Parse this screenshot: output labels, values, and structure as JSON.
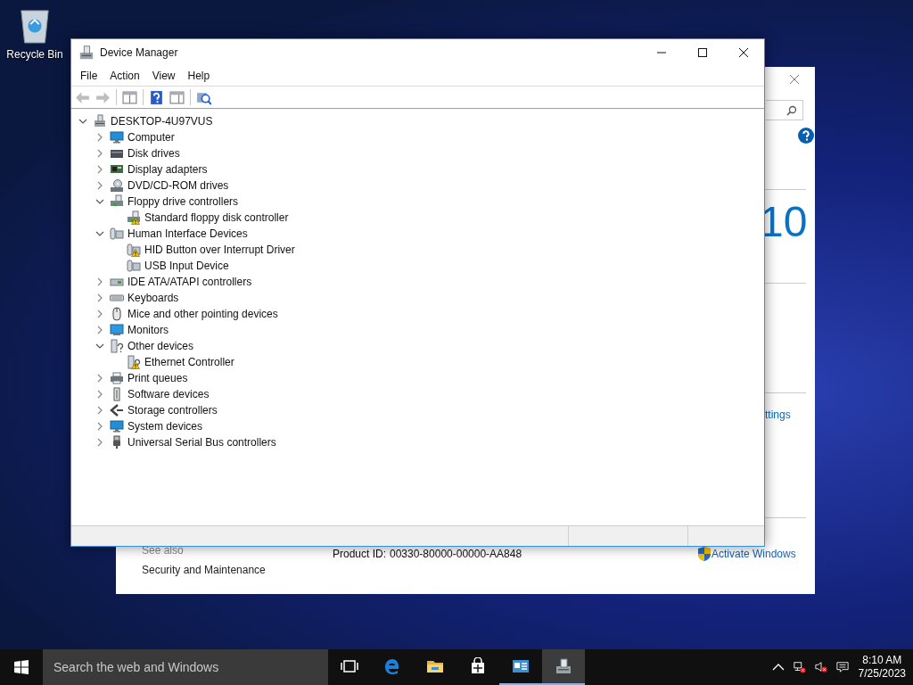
{
  "desktop_icons": [
    {
      "label": "Recycle Bin"
    }
  ],
  "background_window": {
    "logo_text": "10",
    "link": "ttings",
    "see_also": "See also",
    "see_also_link": "Security and Maintenance",
    "product_id_label": "Product ID:",
    "product_id": "00330-80000-00000-AA848",
    "activate_link": "Activate Windows"
  },
  "window": {
    "title": "Device Manager"
  },
  "menu": [
    "File",
    "Action",
    "View",
    "Help"
  ],
  "toolbar": [
    {
      "kind": "back",
      "disabled": true
    },
    {
      "kind": "forward",
      "disabled": true
    },
    {
      "kind": "sep"
    },
    {
      "kind": "console",
      "disabled": false
    },
    {
      "kind": "sep"
    },
    {
      "kind": "help",
      "disabled": false
    },
    {
      "kind": "pane",
      "disabled": false
    },
    {
      "kind": "sep"
    },
    {
      "kind": "scan",
      "disabled": false
    }
  ],
  "tree": {
    "label": "DESKTOP-4U97VUS",
    "kind": "root",
    "expanded": true,
    "children": [
      {
        "label": "Computer",
        "kind": "computer",
        "expanded": false
      },
      {
        "label": "Disk drives",
        "kind": "disk",
        "expanded": false
      },
      {
        "label": "Display adapters",
        "kind": "display",
        "expanded": false
      },
      {
        "label": "DVD/CD-ROM drives",
        "kind": "dvd",
        "expanded": false
      },
      {
        "label": "Floppy drive controllers",
        "kind": "floppy",
        "expanded": true,
        "children": [
          {
            "label": "Standard floppy disk controller",
            "kind": "floppy",
            "warning": true
          }
        ]
      },
      {
        "label": "Human Interface Devices",
        "kind": "hid",
        "expanded": true,
        "children": [
          {
            "label": "HID Button over Interrupt Driver",
            "kind": "hid",
            "warning": true
          },
          {
            "label": "USB Input Device",
            "kind": "hid",
            "warning": false
          }
        ]
      },
      {
        "label": "IDE ATA/ATAPI controllers",
        "kind": "ide",
        "expanded": false
      },
      {
        "label": "Keyboards",
        "kind": "keyboard",
        "expanded": false
      },
      {
        "label": "Mice and other pointing devices",
        "kind": "mouse",
        "expanded": false
      },
      {
        "label": "Monitors",
        "kind": "monitor",
        "expanded": false
      },
      {
        "label": "Other devices",
        "kind": "other",
        "expanded": true,
        "children": [
          {
            "label": "Ethernet Controller",
            "kind": "other",
            "warning": true
          }
        ]
      },
      {
        "label": "Print queues",
        "kind": "printer",
        "expanded": false
      },
      {
        "label": "Software devices",
        "kind": "software",
        "expanded": false
      },
      {
        "label": "Storage controllers",
        "kind": "storage",
        "expanded": false
      },
      {
        "label": "System devices",
        "kind": "computer",
        "expanded": false
      },
      {
        "label": "Universal Serial Bus controllers",
        "kind": "usb",
        "expanded": false
      }
    ]
  },
  "taskbar": {
    "search": {
      "placeholder": "Search the web and Windows"
    },
    "apps": [
      {
        "kind": "taskview",
        "running": false,
        "selected": false
      },
      {
        "kind": "edge",
        "running": false,
        "selected": false
      },
      {
        "kind": "folder",
        "running": false,
        "selected": false
      },
      {
        "kind": "store",
        "running": false,
        "selected": false
      },
      {
        "kind": "panel",
        "running": true,
        "selected": false
      },
      {
        "kind": "devmgr",
        "running": true,
        "selected": true
      }
    ],
    "time": "8:10 AM",
    "date": "7/25/2023"
  }
}
